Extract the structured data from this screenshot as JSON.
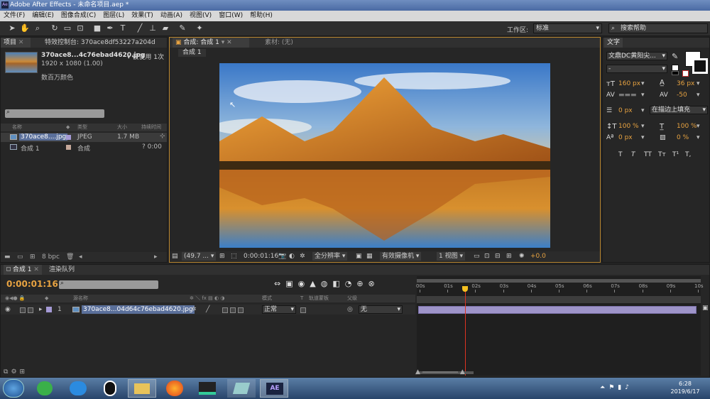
{
  "window": {
    "title": "Adobe After Effects - 未命名项目.aep *",
    "logo_text": "Ae"
  },
  "menu": [
    "文件(F)",
    "编辑(E)",
    "图像合成(C)",
    "图层(L)",
    "效果(T)",
    "动画(A)",
    "视图(V)",
    "窗口(W)",
    "帮助(H)"
  ],
  "toolbar": {
    "workspace_label": "工作区:",
    "workspace_value": "标准",
    "search_help": "搜索帮助"
  },
  "project": {
    "tab_project": "项目",
    "tab_effects": "特效控制台: 370ace8df53227a204d",
    "file_name": "370ace8...4c76ebad4620.jpg",
    "used_text": "被使用 1次",
    "dimensions": "1920 x 1080 (1.00)",
    "colors": "数百万颜色",
    "columns": [
      "名称",
      "类型",
      "大小",
      "持续时间"
    ],
    "items": [
      {
        "name": "370ace8....jpg",
        "type": "JPEG",
        "size": "1.7 MB",
        "duration": ""
      },
      {
        "name": "合成 1",
        "type": "合成",
        "size": "",
        "duration": "? 0:00"
      }
    ],
    "bpc": "8 bpc"
  },
  "composition": {
    "tab_label": "合成: 合成 1",
    "footage_tab": "素材: (无)",
    "crumb": "合成 1",
    "zoom": "(49.7 ...",
    "timecode": "0:00:01:16",
    "resolution": "全分辨率",
    "camera": "有效摄像机",
    "views": "1 视图",
    "exposure": "+0.0"
  },
  "text_panel": {
    "title": "文字",
    "font": "文鼎DC黄阳尖...",
    "style": "-",
    "size": "160 px",
    "leading": "36 px",
    "kerning": "度量标准",
    "tracking": "-50",
    "stroke_width": "0 px",
    "stroke_mode": "在描边上填充",
    "vscale": "100 %",
    "hscale": "100 %",
    "baseline": "0 px",
    "tsume": "0 %",
    "style_buttons": [
      "T",
      "T",
      "TT",
      "Tт",
      "T¹",
      "T,"
    ]
  },
  "timeline": {
    "tab_comp": "合成 1",
    "tab_render": "渲染队列",
    "timecode": "0:00:01:16",
    "col_source": "源名称",
    "col_mode": "模式",
    "col_trkmat": "轨道蒙板",
    "col_parent": "父级",
    "layer_index": "1",
    "layer_name": "370ace8...04d64c76ebad4620.jpg",
    "layer_mode": "正常",
    "layer_parent": "无",
    "ruler_ticks": [
      "00s",
      "01s",
      "02s",
      "03s",
      "04s",
      "05s",
      "06s",
      "07s",
      "08s",
      "09s",
      "10s"
    ],
    "playhead_seconds": 1.64,
    "duration_seconds": 10
  },
  "taskbar": {
    "time": "6:28",
    "date": "2019/6/17",
    "ae_label": "AE"
  }
}
